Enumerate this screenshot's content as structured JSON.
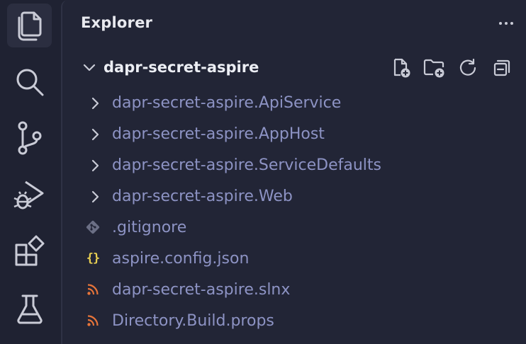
{
  "activity_bar": {
    "items": [
      {
        "name": "explorer",
        "icon": "files-icon",
        "active": true
      },
      {
        "name": "search",
        "icon": "search-icon",
        "active": false
      },
      {
        "name": "source-control",
        "icon": "source-control-icon",
        "active": false
      },
      {
        "name": "run-and-debug",
        "icon": "run-debug-icon",
        "active": false
      },
      {
        "name": "extensions",
        "icon": "extensions-icon",
        "active": false
      },
      {
        "name": "testing",
        "icon": "flask-icon",
        "active": false
      }
    ]
  },
  "sidebar": {
    "title": "Explorer",
    "more_actions": "···",
    "folder": {
      "name": "dapr-secret-aspire",
      "expanded": true,
      "actions": [
        "new-file-icon",
        "new-folder-icon",
        "refresh-icon",
        "collapse-all-icon"
      ]
    },
    "items": [
      {
        "label": "dapr-secret-aspire.ApiService",
        "kind": "folder"
      },
      {
        "label": "dapr-secret-aspire.AppHost",
        "kind": "folder"
      },
      {
        "label": "dapr-secret-aspire.ServiceDefaults",
        "kind": "folder"
      },
      {
        "label": "dapr-secret-aspire.Web",
        "kind": "folder"
      },
      {
        "label": ".gitignore",
        "kind": "file",
        "icon": "git-icon"
      },
      {
        "label": "aspire.config.json",
        "kind": "file",
        "icon": "json-icon",
        "icon_text": "{}"
      },
      {
        "label": "dapr-secret-aspire.slnx",
        "kind": "file",
        "icon": "rss-icon"
      },
      {
        "label": "Directory.Build.props",
        "kind": "file",
        "icon": "rss-icon"
      }
    ]
  },
  "colors": {
    "background": "#1f2232",
    "sidebar": "#222536",
    "icon": "#c9cbd6",
    "tree_text": "#8d93c4",
    "title_text": "#e8e9ef",
    "json_icon": "#e8cf52",
    "rss_icon": "#e6743a",
    "git_icon": "#6b6f85"
  }
}
